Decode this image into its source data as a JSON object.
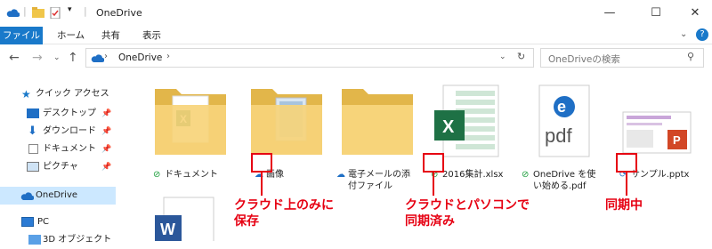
{
  "window": {
    "title": "OneDrive",
    "minimize_icon": "—",
    "maximize_icon": "☐",
    "close_icon": "✕"
  },
  "ribbon": {
    "tabs": [
      "ファイル",
      "ホーム",
      "共有",
      "表示"
    ]
  },
  "address": {
    "crumb": "OneDrive",
    "search_placeholder": "OneDriveの検索"
  },
  "sidebar": {
    "items": [
      {
        "label": "クイック アクセス"
      },
      {
        "label": "デスクトップ"
      },
      {
        "label": "ダウンロード"
      },
      {
        "label": "ドキュメント"
      },
      {
        "label": "ピクチャ"
      },
      {
        "label": "OneDrive"
      },
      {
        "label": "PC"
      },
      {
        "label": "3D オブジェクト"
      }
    ]
  },
  "files": [
    {
      "name": "ドキュメント",
      "status": "synced"
    },
    {
      "name": "画像",
      "status": "cloud"
    },
    {
      "name_line1": "電子メールの添",
      "name_line2": "付ファイル",
      "status": "cloud"
    },
    {
      "name": "2016集計.xlsx",
      "status": "synced"
    },
    {
      "name_line1": "OneDrive を使",
      "name_line2": "い始める.pdf",
      "status": "synced"
    },
    {
      "name": "サンプル.pptx",
      "status": "syncing"
    }
  ],
  "annotations": {
    "cloud_only": {
      "line1": "クラウド上のみに",
      "line2": "保存"
    },
    "synced": {
      "line1": "クラウドとパソコンで",
      "line2": "同期済み"
    },
    "syncing": {
      "line1": "同期中"
    }
  },
  "colors": {
    "accent": "#1979ca",
    "annotation_red": "#e60012",
    "synced_green": "#1a9e3a",
    "cloud_blue": "#1f6fc5"
  }
}
